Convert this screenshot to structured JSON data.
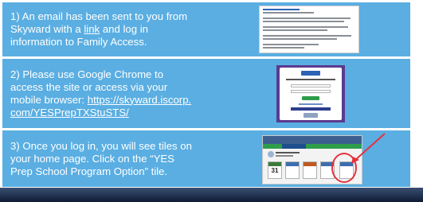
{
  "steps": [
    {
      "text_before": "1) An email has been sent to you from Skyward with a ",
      "link_text": "link",
      "text_after": " and log in information to Family Access."
    },
    {
      "text_before": "2) Please use Google Chrome to access the site or access via your mobile browser: ",
      "link_text": "https://skyward.iscorp.com/YESPrepTXStuSTS/",
      "text_after": ""
    },
    {
      "text_before": "3) Once you log in, you will see tiles on your home page. Click on the “YES Prep School Program Option” tile.",
      "link_text": "",
      "text_after": ""
    }
  ],
  "dashboard": {
    "calendar_day": "31"
  },
  "colors": {
    "row_background": "#5aaee2",
    "highlight": "#e5323e",
    "bottom_bar": "#0f1b33"
  }
}
